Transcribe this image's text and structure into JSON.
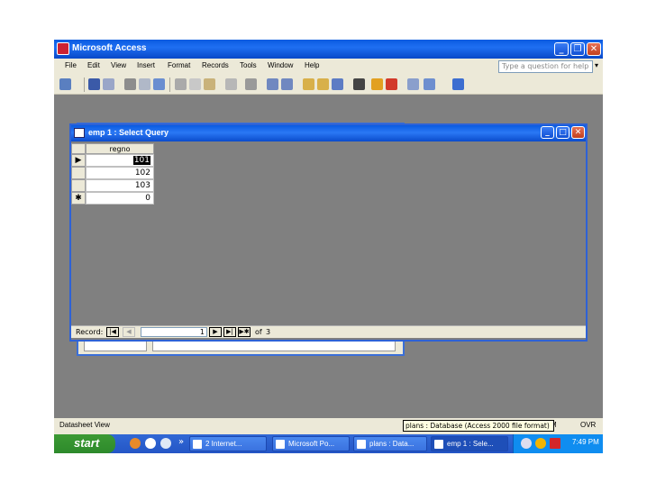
{
  "app": {
    "title": "Microsoft Access"
  },
  "menu": {
    "items": [
      "File",
      "Edit",
      "View",
      "Insert",
      "Format",
      "Records",
      "Tools",
      "Window",
      "Help"
    ],
    "help_placeholder": "Type a question for help"
  },
  "query_window": {
    "title": "emp 1 : Select Query"
  },
  "datasheet": {
    "column": "regno",
    "rows": [
      "101",
      "102",
      "103"
    ],
    "new_row": "0",
    "row_selector_current": "▶",
    "row_selector_new": "✱"
  },
  "navigation": {
    "label": "Record:",
    "current": "1",
    "of_label": "of",
    "total": "3"
  },
  "status": {
    "left": "Datasheet View",
    "right": "OVR",
    "tooltip": "plans : Database (Access 2000 file format)",
    "tooltip_tail": "M"
  },
  "taskbar": {
    "start": "start",
    "overflow": "»",
    "tasks": [
      "2 Internet...",
      "Microsoft Po...",
      "plans : Data...",
      "emp 1 : Sele..."
    ],
    "clock": "7:49 PM"
  },
  "colors": {
    "title_blue": "#0a5be0",
    "workspace_gray": "#808080",
    "taskbar_blue": "#3168d5",
    "start_green": "#3c9a34"
  }
}
